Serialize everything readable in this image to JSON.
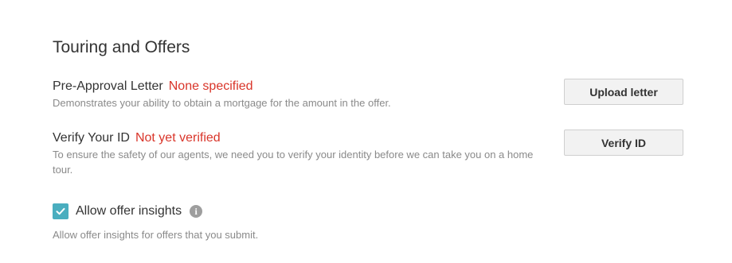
{
  "section": {
    "title": "Touring and Offers"
  },
  "pre_approval": {
    "label": "Pre-Approval Letter",
    "status": "None specified",
    "description": "Demonstrates your ability to obtain a mortgage for the amount in the offer.",
    "button_label": "Upload letter"
  },
  "verify_id": {
    "label": "Verify Your ID",
    "status": "Not yet verified",
    "description": "To ensure the safety of our agents, we need you to verify your identity before we can take you on a home tour.",
    "button_label": "Verify ID"
  },
  "offer_insights": {
    "checked": true,
    "label": "Allow offer insights",
    "info_icon": "info-icon",
    "description": "Allow offer insights for offers that you submit."
  },
  "colors": {
    "status_red": "#d9352a",
    "checkbox_teal": "#4aaebf",
    "muted_text": "#8a8a8a"
  }
}
